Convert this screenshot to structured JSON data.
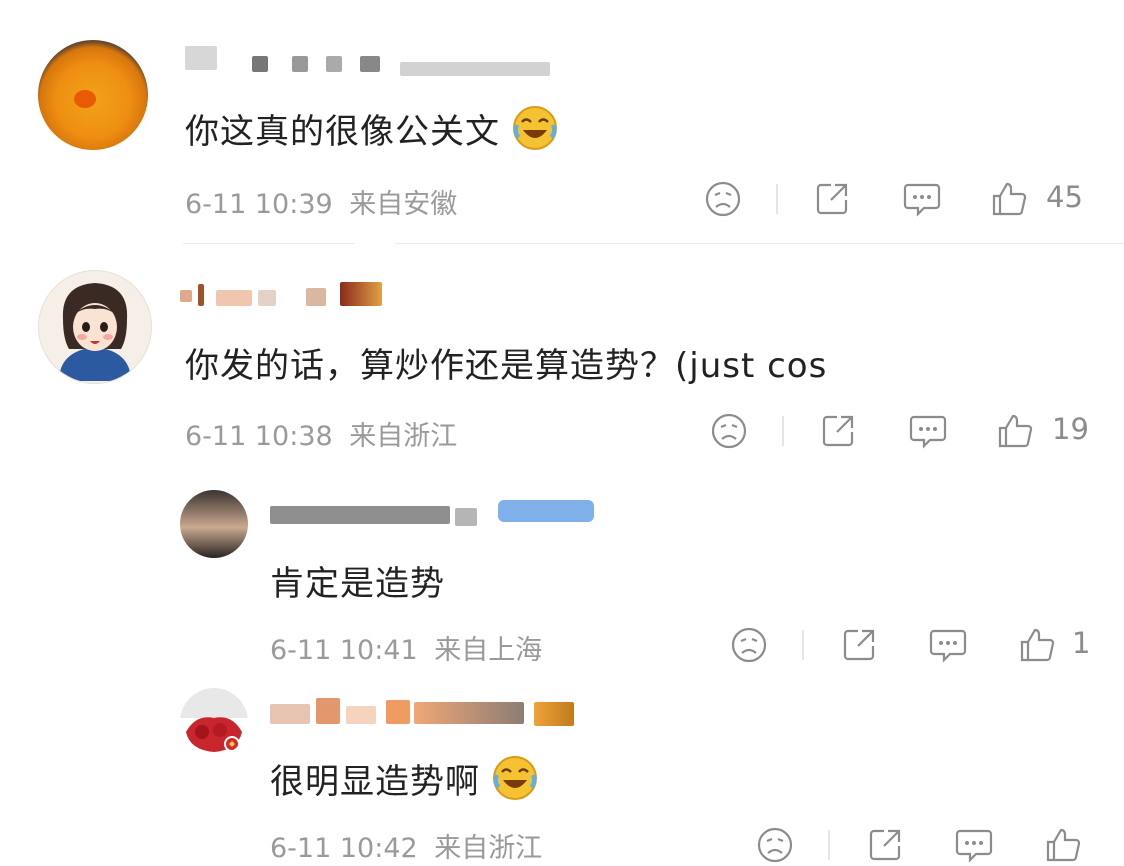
{
  "comments": [
    {
      "text": "你这真的很像公关文",
      "time": "6-11 10:39",
      "location": "来自安徽",
      "likes": "45",
      "emoji": "laugh-cry-emoji"
    },
    {
      "text": "你发的话，算炒作还是算造势？(just cos",
      "time": "6-11 10:38",
      "location": "来自浙江",
      "likes": "19"
    },
    {
      "text": "肯定是造势",
      "time": "6-11 10:41",
      "location": "来自上海",
      "likes": "1"
    },
    {
      "text": "很明显造势啊",
      "time": "6-11 10:42",
      "location": "来自浙江",
      "likes": "",
      "emoji": "laugh-cry-emoji"
    }
  ],
  "icons": {
    "dislike": "frown-face-icon",
    "share": "share-icon",
    "reply": "comment-bubble-icon",
    "like": "thumbs-up-icon"
  },
  "colors": {
    "meta_text": "#9a9a9a",
    "body_text": "#222222",
    "icon": "#8c8c8c",
    "emoji": "#f5c331"
  }
}
